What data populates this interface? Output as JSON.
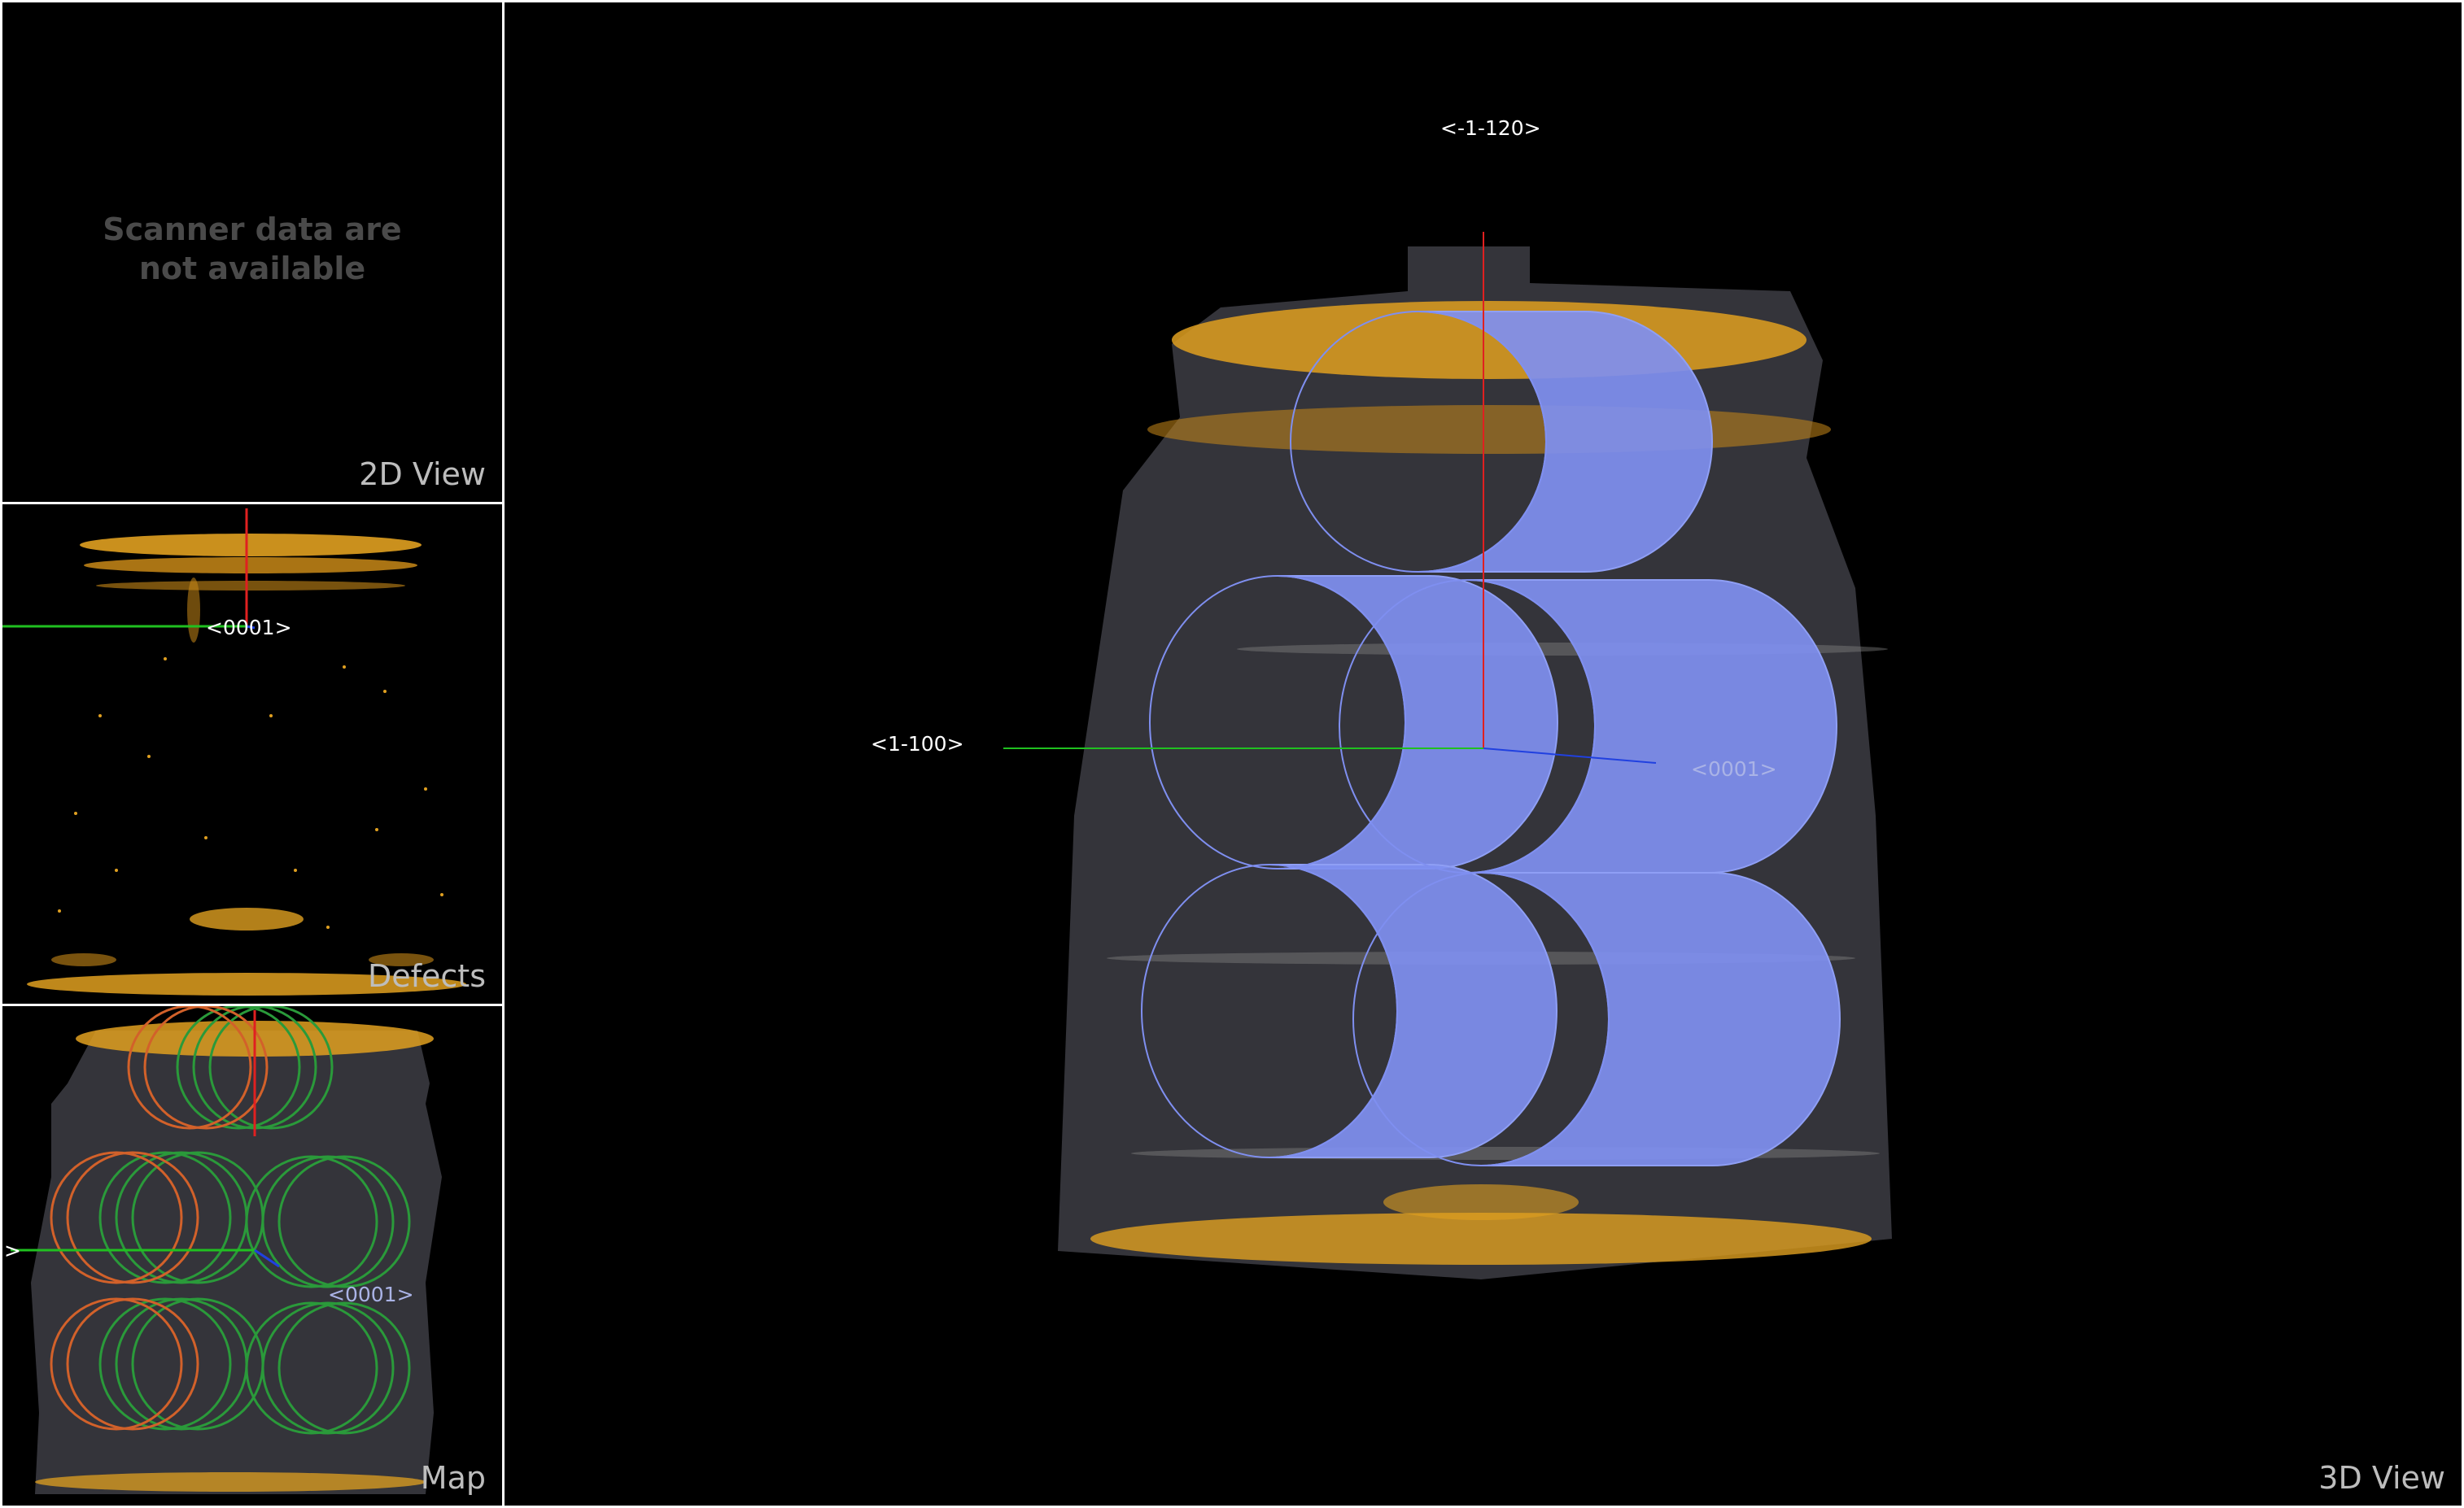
{
  "panels": {
    "view2d": {
      "title": "2D View",
      "message": "Scanner data are\nnot available"
    },
    "defects": {
      "title": "Defects",
      "marker_label": "<0001>"
    },
    "map": {
      "title": "Map",
      "marker_label": "<0001>",
      "axis_label": ">"
    },
    "view3d": {
      "title": "3D View",
      "top_label": "<-1-120>",
      "left_label": "<1-100>",
      "marker_label": "<0001>"
    }
  },
  "colors": {
    "background": "#000000",
    "border": "#ffffff",
    "title_text": "#bdbdbd",
    "defect_points": "#e0a020",
    "pipe_surface": "#34343a",
    "cylinder_fill": "#7f8ff0",
    "axis_x": "#e02020",
    "axis_y": "#20c020",
    "axis_z": "#2040e0",
    "map_green": "#2a9a3a",
    "map_orange": "#d2612a"
  },
  "icons": [
    "axis-gizmo"
  ]
}
